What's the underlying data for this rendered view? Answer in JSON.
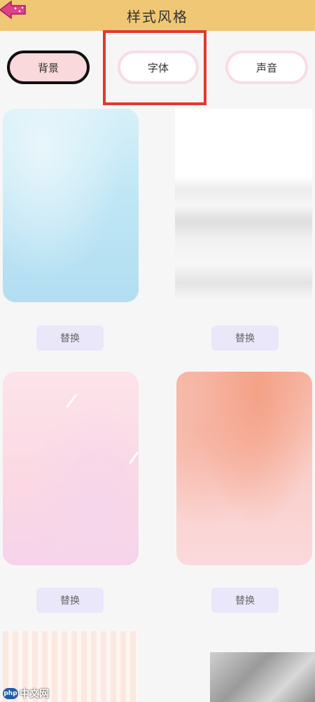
{
  "header": {
    "title": "样式风格",
    "back_icon": "back-arrow-icon"
  },
  "tabs": [
    {
      "label": "背景",
      "selected": true
    },
    {
      "label": "字体",
      "selected": false
    },
    {
      "label": "声音",
      "selected": false
    }
  ],
  "highlight_color": "#e03a30",
  "accent_color": "#f0c774",
  "cards": [
    {
      "action_label": "替换"
    },
    {
      "action_label": "替换"
    },
    {
      "action_label": "替换"
    },
    {
      "action_label": "替换"
    }
  ],
  "watermark": {
    "logo": "php",
    "text": "中文网"
  }
}
